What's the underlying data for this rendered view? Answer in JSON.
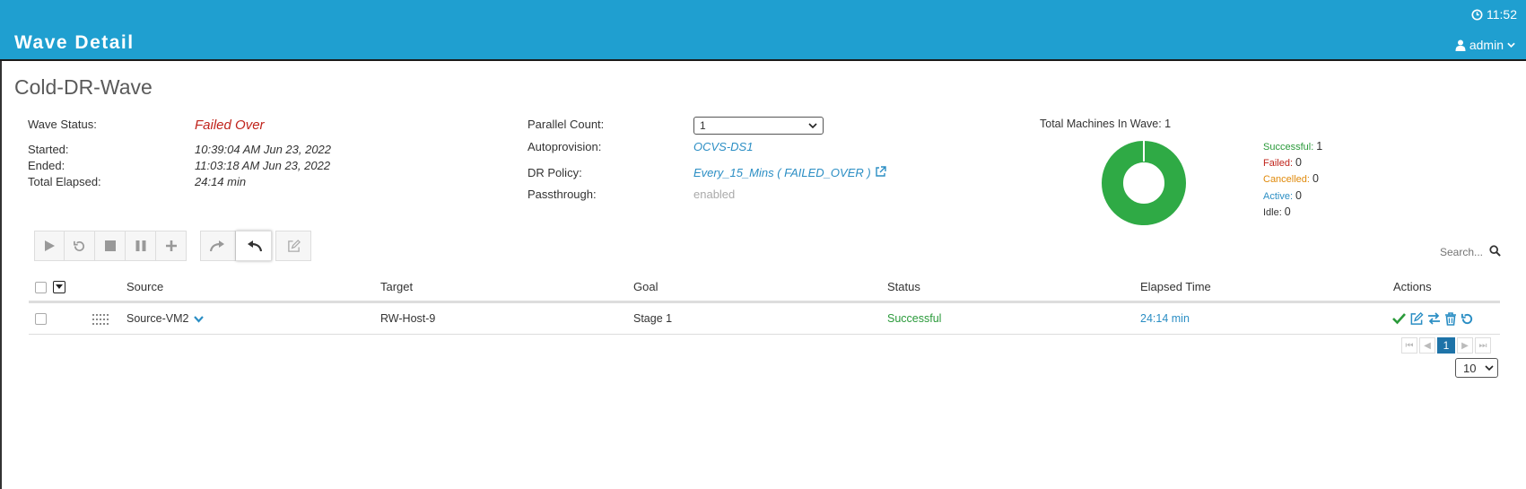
{
  "header": {
    "title": "Wave Detail",
    "clock": "11:52",
    "user": "admin"
  },
  "page": {
    "title": "Cold-DR-Wave"
  },
  "wave": {
    "status_label": "Wave Status:",
    "status_value": "Failed Over",
    "started_label": "Started:",
    "started_value": "10:39:04 AM Jun 23, 2022",
    "ended_label": "Ended:",
    "ended_value": "11:03:18 AM Jun 23, 2022",
    "elapsed_label": "Total Elapsed:",
    "elapsed_value": "24:14 min"
  },
  "config": {
    "parallel_label": "Parallel Count:",
    "parallel_value": "1",
    "autoprovision_label": "Autoprovision:",
    "autoprovision_value": "OCVS-DS1",
    "dr_policy_label": "DR Policy:",
    "dr_policy_value": "Every_15_Mins ( FAILED_OVER )",
    "passthrough_label": "Passthrough:",
    "passthrough_value": "enabled"
  },
  "summary": {
    "title": "Total Machines In Wave: 1",
    "items": [
      {
        "label": "Successful:",
        "count": "1",
        "color": "#2a9a3a"
      },
      {
        "label": "Failed:",
        "count": "0",
        "color": "#c0241c"
      },
      {
        "label": "Cancelled:",
        "count": "0",
        "color": "#e08a0b"
      },
      {
        "label": "Active:",
        "count": "0",
        "color": "#2b8ec4"
      },
      {
        "label": "Idle:",
        "count": "0",
        "color": "#333333"
      }
    ],
    "successful_fraction": 1.0,
    "donut_color": "#2faa45"
  },
  "toolbar": {
    "icons": [
      "play-icon",
      "restart-icon",
      "stop-icon",
      "pause-icon",
      "add-icon",
      "failover-icon",
      "failback-icon",
      "edit-icon"
    ]
  },
  "search": {
    "placeholder": "Search..."
  },
  "table": {
    "columns": [
      "Source",
      "Target",
      "Goal",
      "Status",
      "Elapsed Time",
      "Actions"
    ],
    "rows": [
      {
        "source": "Source-VM2",
        "target": "RW-Host-9",
        "goal": "Stage 1",
        "status": "Successful",
        "elapsed": "24:14 min"
      }
    ]
  },
  "pagination": {
    "current_page": "1",
    "page_size": "10"
  },
  "colors": {
    "header_bg": "#1f9fd0",
    "accent": "#2b8ec4",
    "success": "#2a9a3a",
    "danger": "#c0241c"
  }
}
